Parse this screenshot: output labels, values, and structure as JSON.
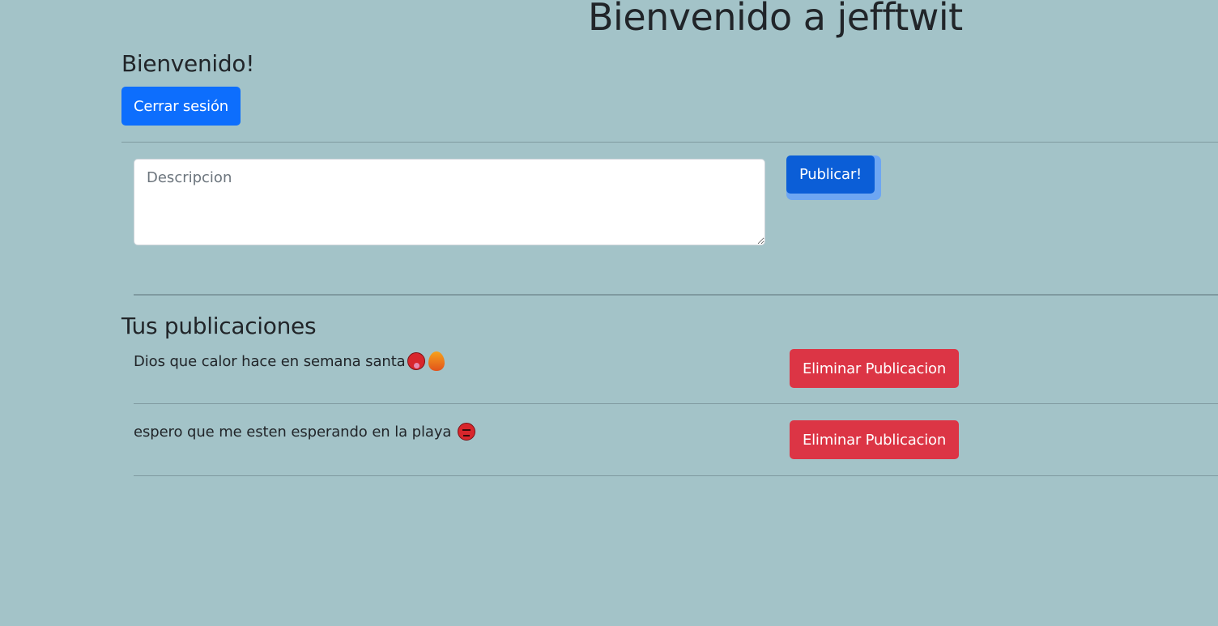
{
  "header": {
    "title": "Bienvenido a jefftwit"
  },
  "user": {
    "welcome": "Bienvenido!",
    "logout_label": "Cerrar sesión"
  },
  "composer": {
    "placeholder": "Descripcion",
    "value": "",
    "publish_label": "Publicar!"
  },
  "posts": {
    "heading": "Tus publicaciones",
    "delete_label": "Eliminar Publicacion",
    "items": [
      {
        "text": "Dios que calor hace en semana santa",
        "icons": [
          "hot-face-icon",
          "fire-icon"
        ]
      },
      {
        "text": "espero que me esten esperando en la playa",
        "icons": [
          "angry-face-icon"
        ]
      }
    ]
  },
  "colors": {
    "background": "#a3c3c8",
    "primary": "#0d6efd",
    "primary_active": "#0b5ed7",
    "danger": "#dc3545"
  }
}
